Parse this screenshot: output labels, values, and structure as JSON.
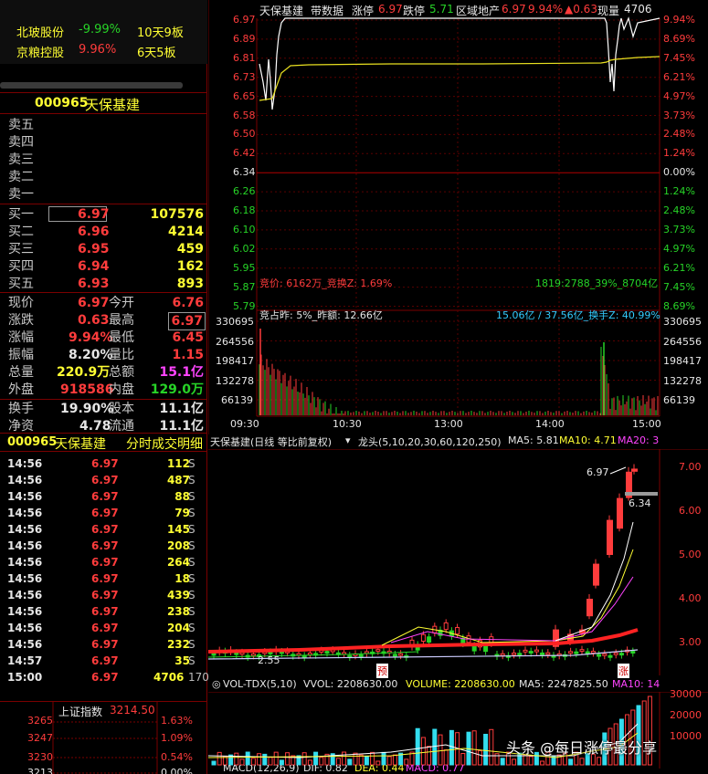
{
  "watchlist": [
    {
      "name": "北玻股份",
      "change": "-9.99%",
      "streak": "10天9板"
    },
    {
      "name": "京粮控股",
      "change": "9.96%",
      "streak": "6天5板"
    }
  ],
  "stock": {
    "code": "000965",
    "name": "天保基建"
  },
  "order_book": {
    "sells": [
      {
        "label": "卖五"
      },
      {
        "label": "卖四"
      },
      {
        "label": "卖三"
      },
      {
        "label": "卖二"
      },
      {
        "label": "卖一"
      }
    ],
    "buys": [
      {
        "label": "买一",
        "price": "6.97",
        "vol": "107576"
      },
      {
        "label": "买二",
        "price": "6.96",
        "vol": "4214"
      },
      {
        "label": "买三",
        "price": "6.95",
        "vol": "459"
      },
      {
        "label": "买四",
        "price": "6.94",
        "vol": "162"
      },
      {
        "label": "买五",
        "price": "6.93",
        "vol": "893"
      }
    ]
  },
  "quote": {
    "rows": [
      {
        "l1": "现价",
        "v1": "6.97",
        "l2": "今开",
        "v2": "6.76"
      },
      {
        "l1": "涨跌",
        "v1": "0.63",
        "l2": "最高",
        "v2": "6.97"
      },
      {
        "l1": "涨幅",
        "v1": "9.94%",
        "l2": "最低",
        "v2": "6.45"
      },
      {
        "l1": "振幅",
        "v1": "8.20%",
        "l2": "量比",
        "v2": "1.15"
      },
      {
        "l1": "总量",
        "v1": "220.9万",
        "l2": "总额",
        "v2": "15.1亿"
      },
      {
        "l1": "外盘",
        "v1": "918586",
        "l2": "内盘",
        "v2": "129.0万"
      },
      {
        "l1": "换手",
        "v1": "19.90%",
        "l2": "股本",
        "v2": "11.1亿"
      },
      {
        "l1": "净资",
        "v1": "4.78",
        "l2": "流通",
        "v2": "11.1亿"
      }
    ]
  },
  "ticks_header": {
    "code": "000965",
    "name": "天保基建",
    "title": "分时成交明细"
  },
  "ticks": [
    {
      "time": "14:56",
      "price": "6.97",
      "vol": "112",
      "flag": "S"
    },
    {
      "time": "14:56",
      "price": "6.97",
      "vol": "487",
      "flag": "S"
    },
    {
      "time": "14:56",
      "price": "6.97",
      "vol": "88",
      "flag": "S"
    },
    {
      "time": "14:56",
      "price": "6.97",
      "vol": "79",
      "flag": "S"
    },
    {
      "time": "14:56",
      "price": "6.97",
      "vol": "145",
      "flag": "S"
    },
    {
      "time": "14:56",
      "price": "6.97",
      "vol": "208",
      "flag": "S"
    },
    {
      "time": "14:56",
      "price": "6.97",
      "vol": "264",
      "flag": "S"
    },
    {
      "time": "14:56",
      "price": "6.97",
      "vol": "18",
      "flag": "S"
    },
    {
      "time": "14:56",
      "price": "6.97",
      "vol": "439",
      "flag": "S"
    },
    {
      "time": "14:56",
      "price": "6.97",
      "vol": "238",
      "flag": "S"
    },
    {
      "time": "14:56",
      "price": "6.97",
      "vol": "204",
      "flag": "S"
    },
    {
      "time": "14:56",
      "price": "6.97",
      "vol": "232",
      "flag": "S"
    },
    {
      "time": "14:57",
      "price": "6.97",
      "vol": "35",
      "flag": "S"
    },
    {
      "time": "15:00",
      "price": "6.97",
      "vol": "4706",
      "flag": "170"
    }
  ],
  "index_mini": {
    "name": "上证指数",
    "value": "3214.50",
    "levels": [
      "3265",
      "3247",
      "3230",
      "3213"
    ],
    "pcts": [
      "1.63%",
      "1.09%",
      "0.54%",
      "0.00%"
    ]
  },
  "intraday": {
    "title": "天保基建",
    "tags": [
      "带数据",
      "涨停",
      "跌停",
      "区域地产",
      "现量"
    ],
    "limit_up": "6.97",
    "limit_down": "5.71",
    "price": "6.97",
    "pct": "9.94%",
    "chg": "▲0.63",
    "now_vol": "4706",
    "price_ticks": [
      "6.97",
      "6.89",
      "6.81",
      "6.73",
      "6.65",
      "6.58",
      "6.50",
      "6.42",
      "6.34",
      "6.26",
      "6.18",
      "6.10",
      "6.02",
      "5.95",
      "5.87",
      "5.79"
    ],
    "pct_ticks": [
      "9.94%",
      "8.69%",
      "7.45%",
      "6.21%",
      "4.97%",
      "3.73%",
      "2.48%",
      "1.24%",
      "0.00%",
      "1.24%",
      "2.48%",
      "3.73%",
      "4.97%",
      "6.21%",
      "7.45%",
      "8.69%"
    ],
    "auction_left": "竞价: 6162万_竞换Z: 1.69%",
    "auction_right": "1819:2788_39%_8704亿",
    "vol_header_left": "竞占昨: 5%_昨额: 12.66亿",
    "vol_header_right": "15.06亿 / 37.56亿_换手Z: 40.99%",
    "vol_ticks": [
      "330695",
      "264556",
      "198417",
      "132278",
      "66139"
    ],
    "time_ticks": [
      "09:30",
      "10:30",
      "13:00",
      "14:00",
      "15:00"
    ]
  },
  "daily": {
    "title": "天保基建(日线 等比前复权)",
    "indicator": "龙头(5,10,20,30,60,120,250)",
    "ma5": "MA5: 5.81",
    "ma10": "MA10: 4.71",
    "ma20": "MA20: 3",
    "high_label": "6.97",
    "last_label": "6.34",
    "low_label": "2.55",
    "price_ticks": [
      "7.00",
      "6.00",
      "5.00",
      "4.00",
      "3.00"
    ],
    "marker_pre": "预",
    "marker_zhang": "涨"
  },
  "volume": {
    "label": "VOL-TDX(5,10)",
    "vvol": "VVOL: 2208630.00",
    "volume": "VOLUME: 2208630.00",
    "ma5": "MA5: 2247825.50",
    "ma10": "MA10: 14",
    "ticks": [
      "30000",
      "20000",
      "10000"
    ]
  },
  "macd": {
    "label": "MACD(12,26,9)",
    "dif": "DIF: 0.82",
    "dea": "DEA: 0.44",
    "macd": "MACD: 0.77"
  },
  "watermark": "头条 @每日涨停最分享",
  "colors": {
    "up": "#ff3c3c",
    "down": "#27d327",
    "text": "#c8c8c8",
    "grid": "#7a0000",
    "yellow": "#ffff33"
  }
}
